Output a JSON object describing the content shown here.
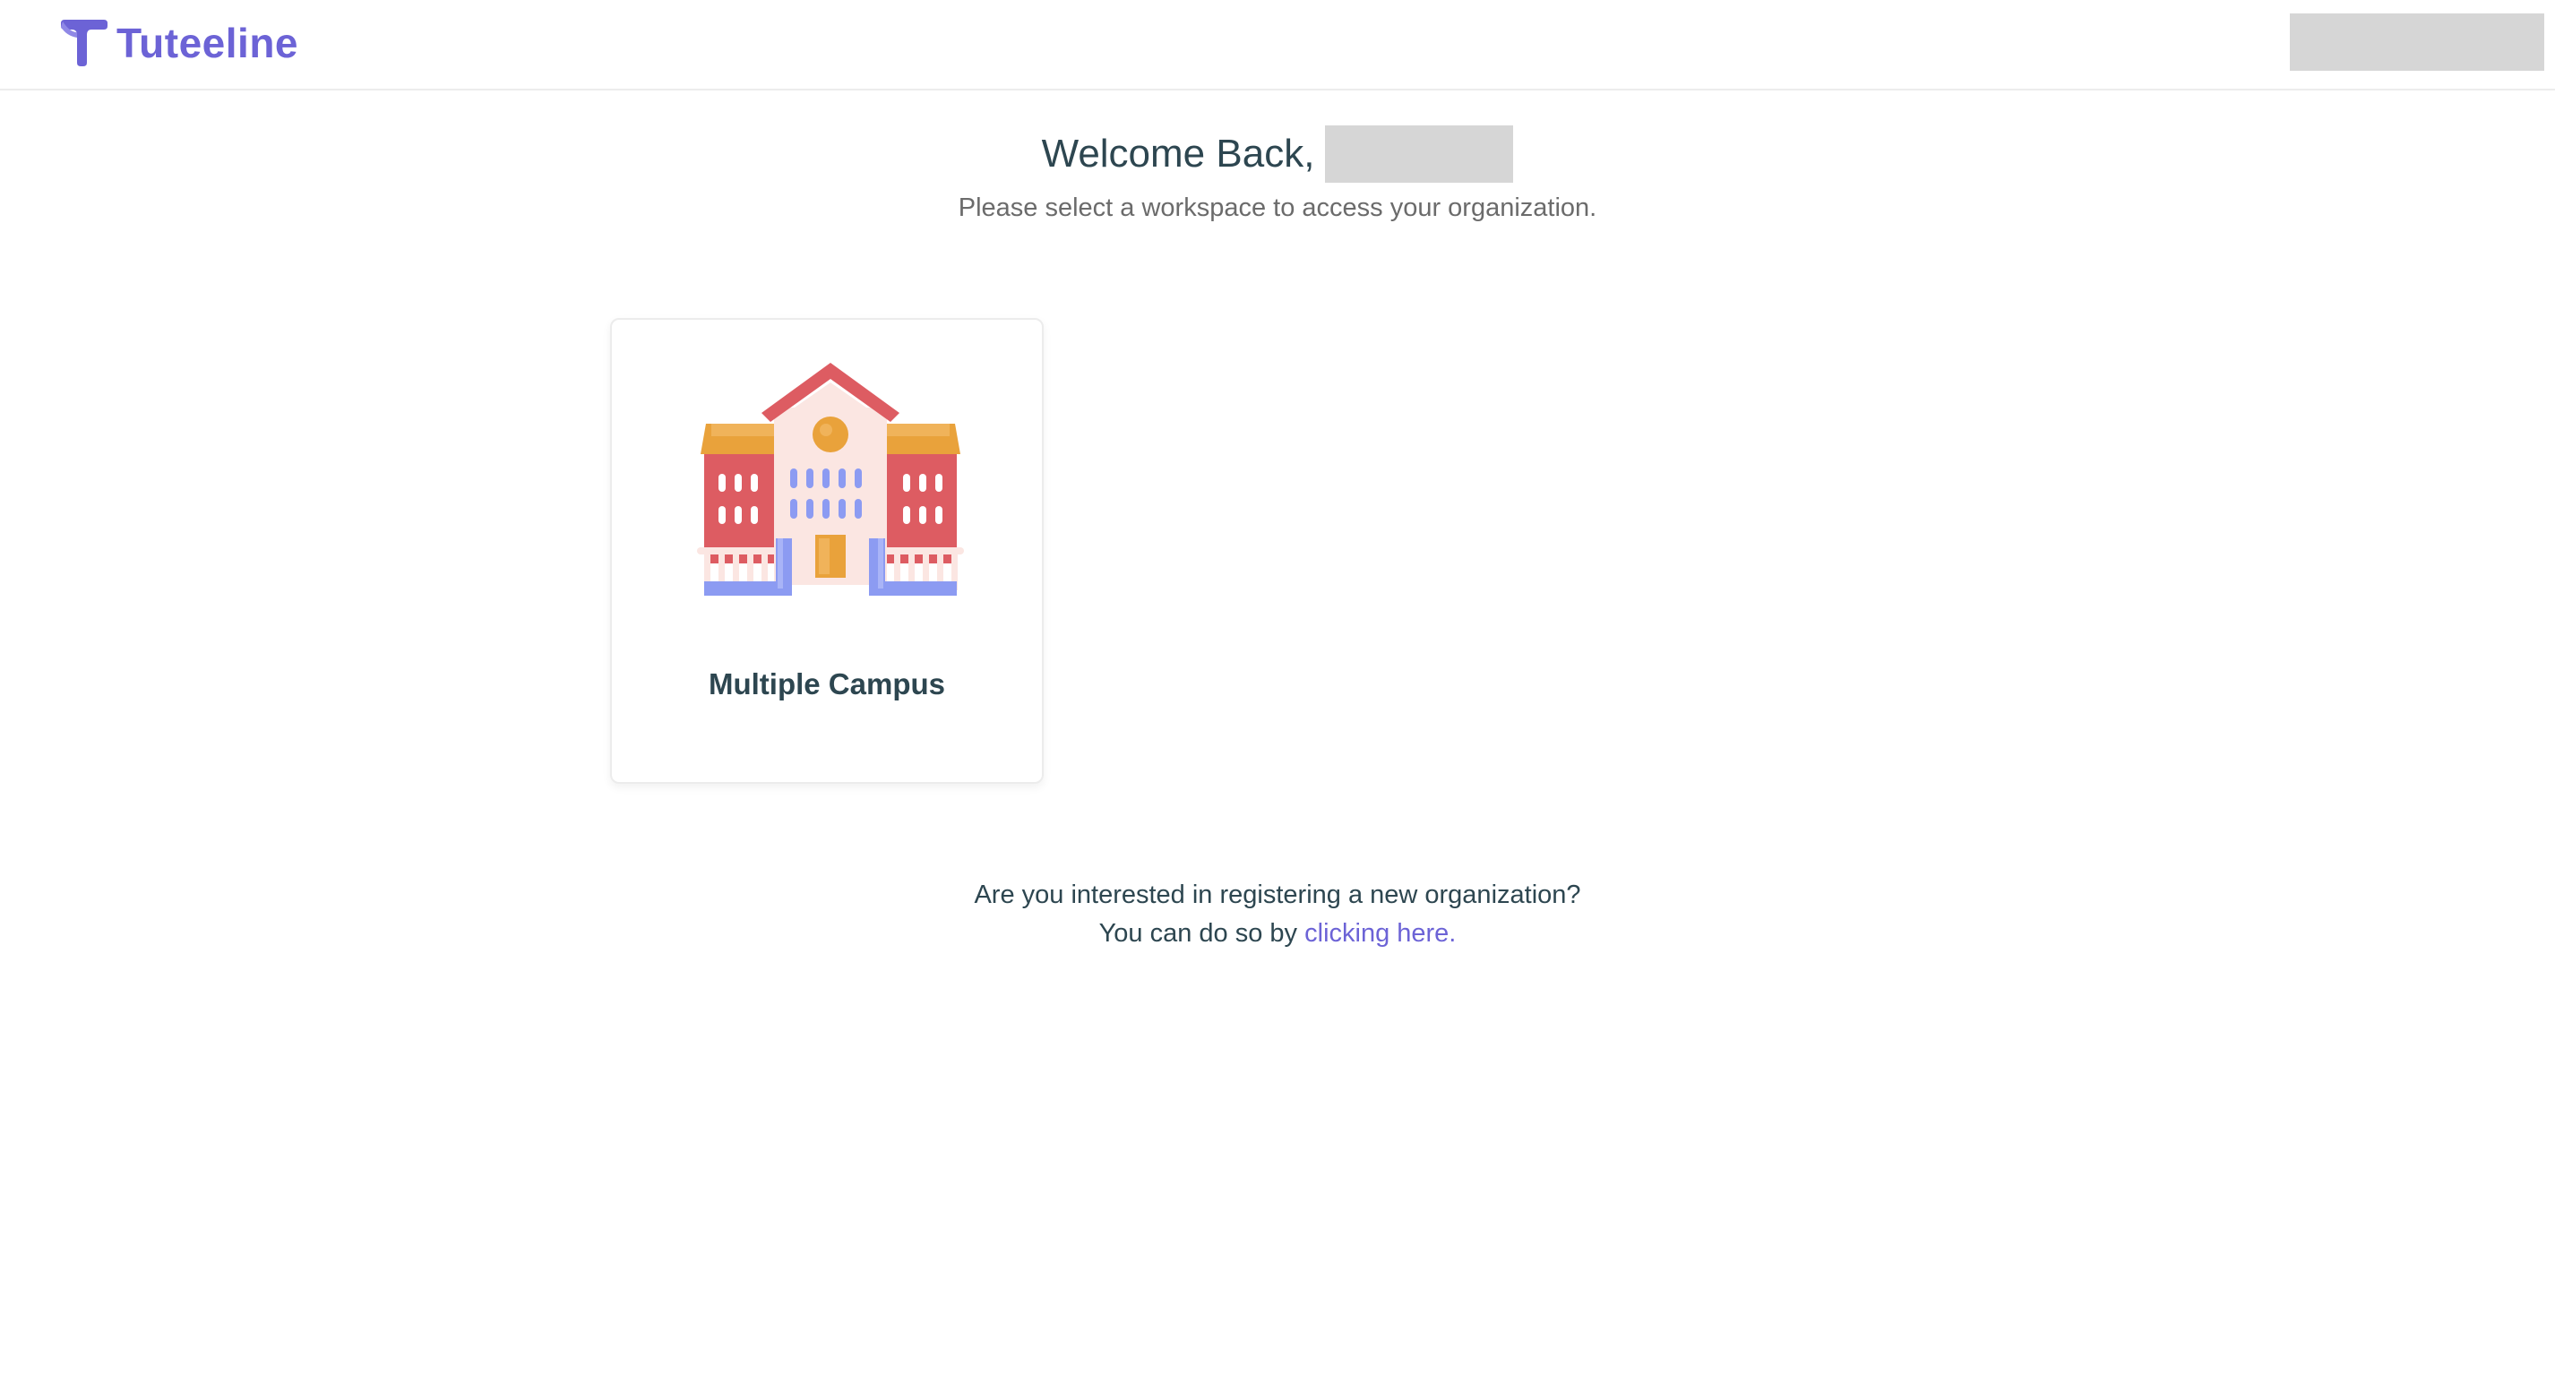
{
  "header": {
    "brand_name": "Tuteeline",
    "brand_color": "#6c63d6"
  },
  "welcome": {
    "greeting": "Welcome Back,",
    "subtitle": "Please select a workspace to access your organization."
  },
  "workspaces": [
    {
      "name": "Multiple Campus",
      "icon": "school-building-icon"
    }
  ],
  "register": {
    "question": "Are you interested in registering a new organization?",
    "prompt": "You can do so by",
    "link_label": "clicking here."
  }
}
